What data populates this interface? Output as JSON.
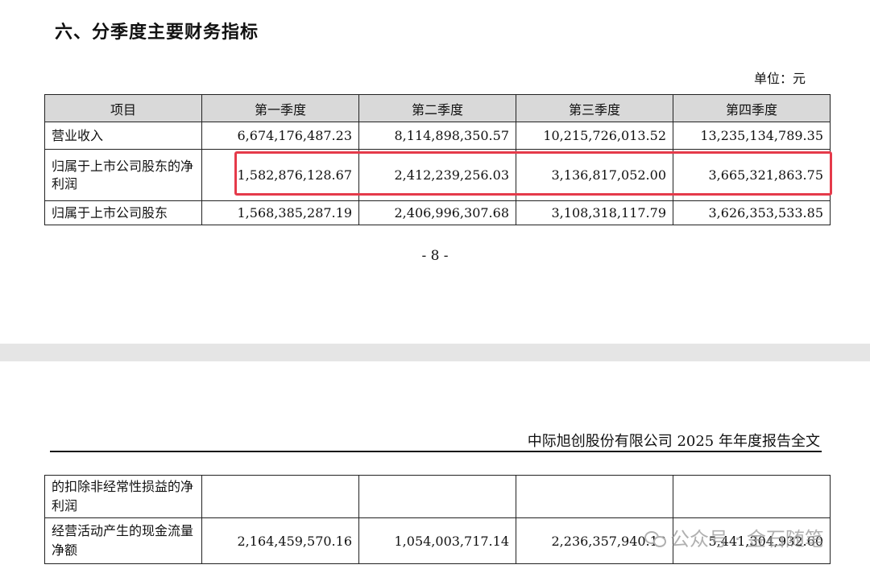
{
  "section_title": "六、分季度主要财务指标",
  "unit": "单位：元",
  "table": {
    "headers": [
      "项目",
      "第一季度",
      "第二季度",
      "第三季度",
      "第四季度"
    ],
    "rows": [
      {
        "label": "营业收入",
        "values": [
          "6,674,176,487.23",
          "8,114,898,350.57",
          "10,215,726,013.52",
          "13,235,134,789.35"
        ]
      },
      {
        "label": "归属于上市公司股东的净利润",
        "values": [
          "1,582,876,128.67",
          "2,412,239,256.03",
          "3,136,817,052.00",
          "3,665,321,863.75"
        ]
      },
      {
        "label": "归属于上市公司股东",
        "values": [
          "1,568,385,287.19",
          "2,406,996,307.68",
          "3,108,318,117.79",
          "3,626,353,533.85"
        ]
      }
    ]
  },
  "page_number": "- 8 -",
  "page_header": "中际旭创股份有限公司 2025 年年度报告全文",
  "table_continued": {
    "rows": [
      {
        "label": "的扣除非经常性损益的净利润",
        "values": [
          "",
          "",
          "",
          ""
        ]
      },
      {
        "label": "经营活动产生的现金流量净额",
        "values": [
          "2,164,459,570.16",
          "1,054,003,717.14",
          "2,236,357,940.13",
          "5,441,304,932.60"
        ]
      }
    ]
  },
  "watermark": "公众号 · 金石随笔",
  "colors": {
    "highlight": "#e53a4a",
    "header_bg": "#d9d9d9",
    "page_gap": "#e5e5e5"
  }
}
